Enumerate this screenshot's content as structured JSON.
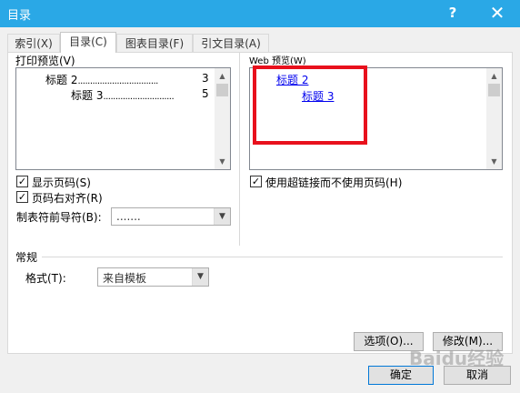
{
  "window": {
    "title": "目录",
    "help_label": "?",
    "close_label": "✕"
  },
  "tabs": [
    {
      "label": "索引(X)",
      "active": false
    },
    {
      "label": "目录(C)",
      "active": true
    },
    {
      "label": "图表目录(F)",
      "active": false
    },
    {
      "label": "引文目录(A)",
      "active": false
    }
  ],
  "print_preview": {
    "label": "打印预览(V)",
    "entries": [
      {
        "text": "标题 2",
        "leader": ".................................",
        "page": "3"
      },
      {
        "text": "标题 3",
        "leader": ".............................",
        "page": "5"
      }
    ]
  },
  "web_preview": {
    "label": "Web 预览(W)",
    "entries": [
      {
        "text": "标题 2"
      },
      {
        "text": "标题 3"
      }
    ]
  },
  "options": {
    "show_page_numbers": {
      "label": "显示页码(S)",
      "checked": true
    },
    "right_align": {
      "label": "页码右对齐(R)",
      "checked": true
    },
    "tab_leader": {
      "label": "制表符前导符(B):",
      "value": "......."
    },
    "use_hyperlinks": {
      "label": "使用超链接而不使用页码(H)",
      "checked": true
    }
  },
  "general": {
    "section_label": "常规",
    "format_label": "格式(T):",
    "format_value": "来自模板"
  },
  "buttons": {
    "options": "选项(O)...",
    "modify": "修改(M)...",
    "ok": "确定",
    "cancel": "取消"
  },
  "watermark": "Baidu经验"
}
